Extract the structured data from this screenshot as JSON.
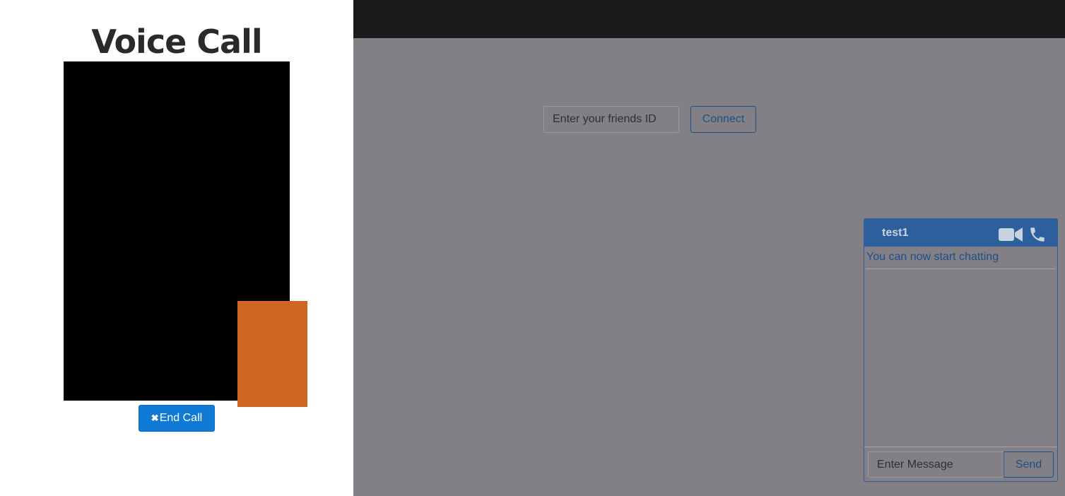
{
  "call_panel": {
    "title": "Voice Call",
    "end_call_icon": "✖",
    "end_call_label": "End Call"
  },
  "connect": {
    "placeholder": "Enter your friends ID",
    "button_label": "Connect"
  },
  "chat": {
    "username": "test1",
    "status": "You can now start chatting",
    "input_placeholder": "Enter Message",
    "send_label": "Send",
    "icons": [
      "video-camera-icon",
      "phone-icon"
    ]
  },
  "colors": {
    "topbar": "#1b1b1e",
    "overlay_bg": "#828085",
    "accent": "#2c5f9b",
    "end_call": "#0f7ad6",
    "local_video": "#d06720"
  }
}
